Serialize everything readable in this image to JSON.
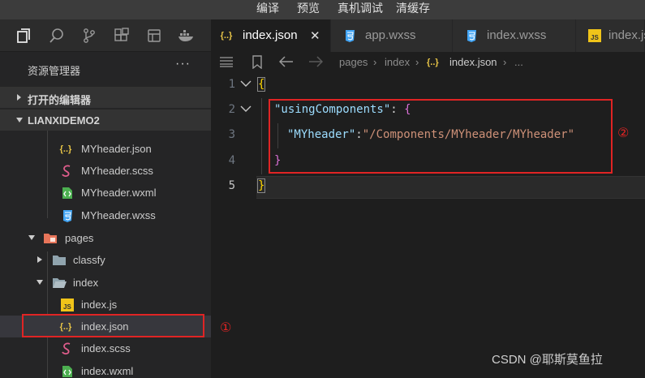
{
  "menu": {
    "items": [
      "编译",
      "预览",
      "真机调试",
      "清缓存"
    ]
  },
  "activity_icons": [
    "files-icon",
    "search-icon",
    "source-control-icon",
    "extensions-icon",
    "wechat-cloud-icon",
    "docker-icon"
  ],
  "explorer": {
    "title": "资源管理器",
    "more": "···",
    "open_editors_label": "打开的编辑器",
    "project_label": "LIANXIDEMO2"
  },
  "tree": [
    {
      "name": "MYheader.json",
      "icon": "json-icon"
    },
    {
      "name": "MYheader.scss",
      "icon": "scss-icon"
    },
    {
      "name": "MYheader.wxml",
      "icon": "wxml-icon"
    },
    {
      "name": "MYheader.wxss",
      "icon": "wxss-icon"
    },
    {
      "name": "pages",
      "icon": "folder-pages-icon"
    },
    {
      "name": "classfy",
      "icon": "folder-icon"
    },
    {
      "name": "index",
      "icon": "folder-open-icon"
    },
    {
      "name": "index.js",
      "icon": "js-icon"
    },
    {
      "name": "index.json",
      "icon": "json-icon"
    },
    {
      "name": "index.scss",
      "icon": "scss-icon"
    },
    {
      "name": "index.wxml",
      "icon": "wxml-icon"
    }
  ],
  "tabs": [
    {
      "label": "index.json",
      "icon": "json-icon",
      "active": true,
      "close": "✕"
    },
    {
      "label": "app.wxss",
      "icon": "wxss-icon",
      "active": false
    },
    {
      "label": "index.wxss",
      "icon": "wxss-icon",
      "active": false
    },
    {
      "label": "index.js",
      "icon": "js-icon",
      "active": false
    }
  ],
  "breadcrumb": {
    "parts": [
      "pages",
      "index",
      "index.json",
      "..."
    ]
  },
  "editor": {
    "line_numbers": [
      "1",
      "2",
      "3",
      "4",
      "5"
    ],
    "lines": [
      {
        "brace_open": "{"
      },
      {
        "key": "\"usingComponents\"",
        "colon": ": ",
        "brace": "{"
      },
      {
        "key": "\"MYheader\"",
        "colon": ":",
        "value": "\"/Components/MYheader/MYheader\""
      },
      {
        "brace": "}"
      },
      {
        "brace_close": "}"
      }
    ]
  },
  "annotations": {
    "marker1": "①",
    "marker2": "②",
    "box_color": "#e02424"
  },
  "watermark": "CSDN @耶斯莫鱼拉"
}
